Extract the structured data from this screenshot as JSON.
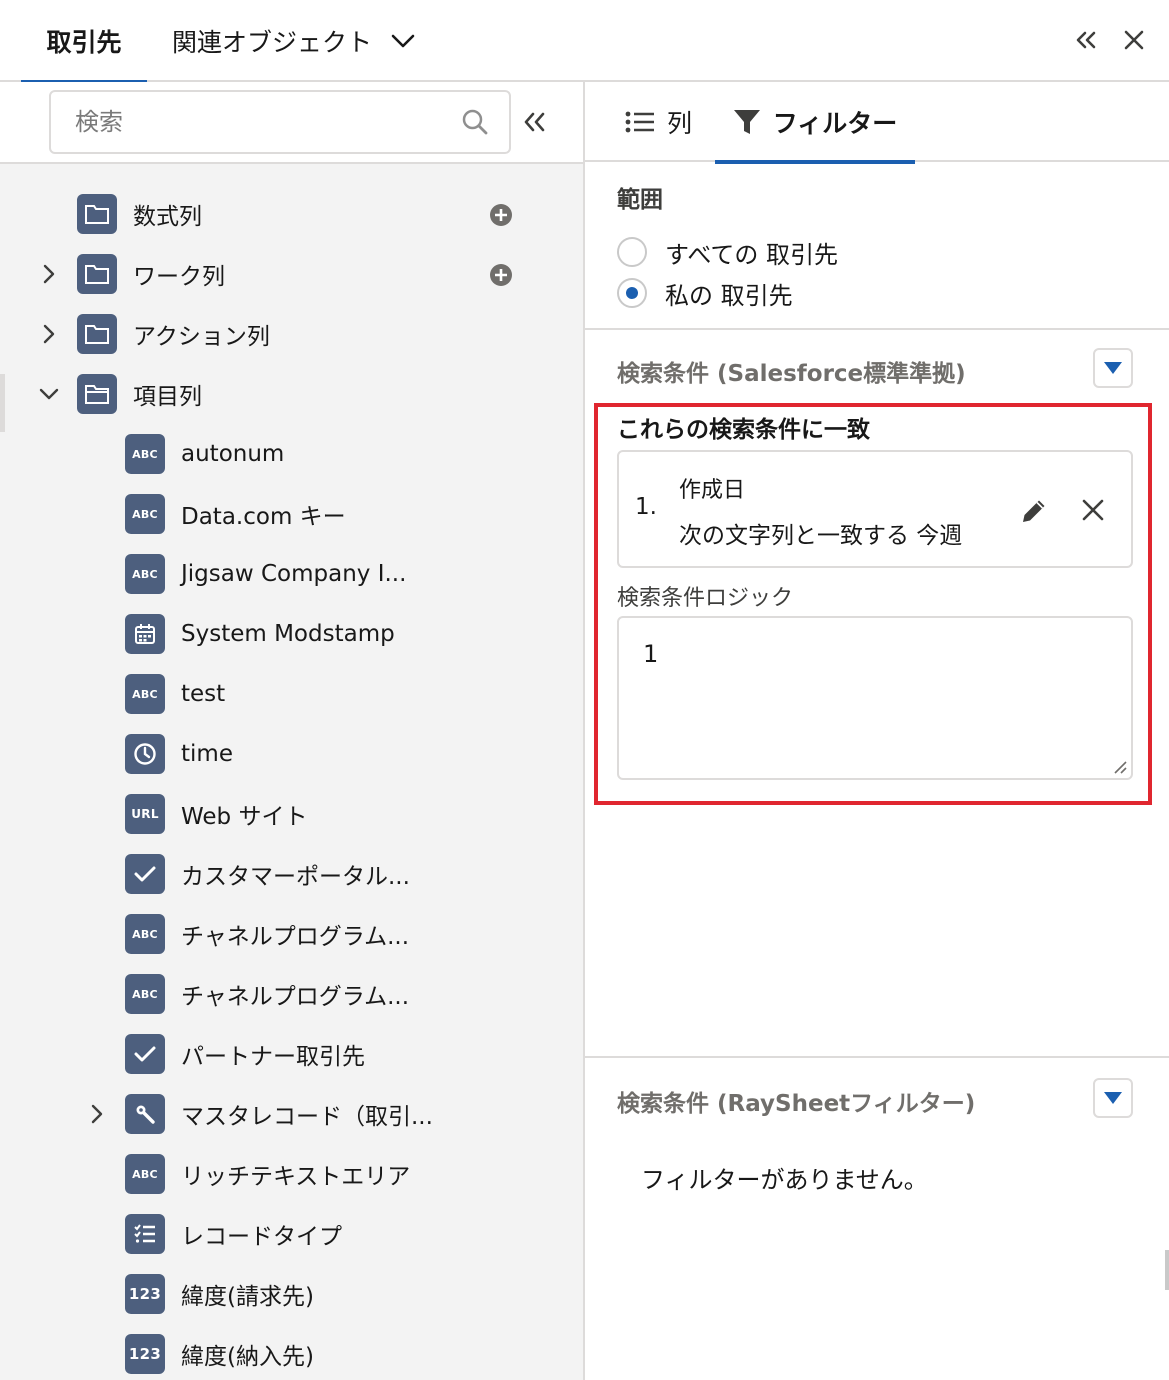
{
  "header": {
    "tab_active": "取引先",
    "tab_related": "関連オブジェクト"
  },
  "left_panel": {
    "search_placeholder": "検索",
    "folders": [
      {
        "label": "数式列",
        "expandable": false,
        "has_add": true
      },
      {
        "label": "ワーク列",
        "expandable": true,
        "has_add": true
      },
      {
        "label": "アクション列",
        "expandable": true,
        "has_add": false
      },
      {
        "label": "項目列",
        "expandable": true,
        "expanded": true,
        "has_add": false
      }
    ],
    "fields": [
      {
        "icon": "ABC",
        "label": "autonum"
      },
      {
        "icon": "ABC",
        "label": "Data.com キー"
      },
      {
        "icon": "ABC",
        "label": "Jigsaw Company I..."
      },
      {
        "icon": "calendar-icon",
        "label": "System Modstamp"
      },
      {
        "icon": "ABC",
        "label": "test"
      },
      {
        "icon": "clock-icon",
        "label": "time"
      },
      {
        "icon": "URL",
        "label": "Web サイト"
      },
      {
        "icon": "checkbox-icon",
        "label": "カスタマーポータル..."
      },
      {
        "icon": "ABC",
        "label": "チャネルプログラム..."
      },
      {
        "icon": "ABC",
        "label": "チャネルプログラム..."
      },
      {
        "icon": "checkbox-icon",
        "label": "パートナー取引先"
      },
      {
        "icon": "lookup-icon",
        "label": "マスタレコード（取引...",
        "expandable": true
      },
      {
        "icon": "ABC",
        "label": "リッチテキストエリア"
      },
      {
        "icon": "picklist-icon",
        "label": "レコードタイプ"
      },
      {
        "icon": "123",
        "label": "緯度(請求先)"
      },
      {
        "icon": "123",
        "label": "緯度(納入先)"
      }
    ]
  },
  "right_panel": {
    "tab_columns": "列",
    "tab_filter": "フィルター",
    "scope": {
      "title": "範囲",
      "options": [
        "すべての 取引先",
        "私の 取引先"
      ],
      "selected": 1
    },
    "standard_filter": {
      "title": "検索条件 (Salesforce標準準拠)",
      "match_title": "これらの検索条件に一致",
      "condition": {
        "number": "1.",
        "field": "作成日",
        "operator_value": "次の文字列と一致する 今週"
      },
      "logic_label": "検索条件ロジック",
      "logic_value": "1"
    },
    "raysheet_filter": {
      "title": "検索条件 (RaySheetフィルター)",
      "empty_message": "フィルターがありません。"
    }
  },
  "colors": {
    "accent_blue": "#1b5fb0",
    "icon_slate": "#4d5f7e",
    "highlight_red": "#e0262f",
    "border_gray": "#dddbda"
  }
}
